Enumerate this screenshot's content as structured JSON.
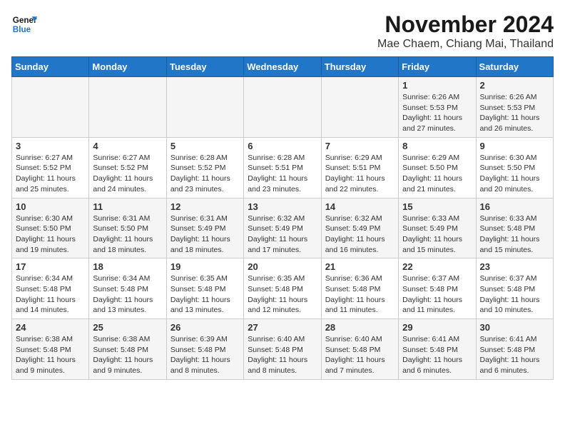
{
  "header": {
    "logo_line1": "General",
    "logo_line2": "Blue",
    "month": "November 2024",
    "location": "Mae Chaem, Chiang Mai, Thailand"
  },
  "weekdays": [
    "Sunday",
    "Monday",
    "Tuesday",
    "Wednesday",
    "Thursday",
    "Friday",
    "Saturday"
  ],
  "weeks": [
    [
      {
        "day": "",
        "sunrise": "",
        "sunset": "",
        "daylight": ""
      },
      {
        "day": "",
        "sunrise": "",
        "sunset": "",
        "daylight": ""
      },
      {
        "day": "",
        "sunrise": "",
        "sunset": "",
        "daylight": ""
      },
      {
        "day": "",
        "sunrise": "",
        "sunset": "",
        "daylight": ""
      },
      {
        "day": "",
        "sunrise": "",
        "sunset": "",
        "daylight": ""
      },
      {
        "day": "1",
        "sunrise": "Sunrise: 6:26 AM",
        "sunset": "Sunset: 5:53 PM",
        "daylight": "Daylight: 11 hours and 27 minutes."
      },
      {
        "day": "2",
        "sunrise": "Sunrise: 6:26 AM",
        "sunset": "Sunset: 5:53 PM",
        "daylight": "Daylight: 11 hours and 26 minutes."
      }
    ],
    [
      {
        "day": "3",
        "sunrise": "Sunrise: 6:27 AM",
        "sunset": "Sunset: 5:52 PM",
        "daylight": "Daylight: 11 hours and 25 minutes."
      },
      {
        "day": "4",
        "sunrise": "Sunrise: 6:27 AM",
        "sunset": "Sunset: 5:52 PM",
        "daylight": "Daylight: 11 hours and 24 minutes."
      },
      {
        "day": "5",
        "sunrise": "Sunrise: 6:28 AM",
        "sunset": "Sunset: 5:52 PM",
        "daylight": "Daylight: 11 hours and 23 minutes."
      },
      {
        "day": "6",
        "sunrise": "Sunrise: 6:28 AM",
        "sunset": "Sunset: 5:51 PM",
        "daylight": "Daylight: 11 hours and 23 minutes."
      },
      {
        "day": "7",
        "sunrise": "Sunrise: 6:29 AM",
        "sunset": "Sunset: 5:51 PM",
        "daylight": "Daylight: 11 hours and 22 minutes."
      },
      {
        "day": "8",
        "sunrise": "Sunrise: 6:29 AM",
        "sunset": "Sunset: 5:50 PM",
        "daylight": "Daylight: 11 hours and 21 minutes."
      },
      {
        "day": "9",
        "sunrise": "Sunrise: 6:30 AM",
        "sunset": "Sunset: 5:50 PM",
        "daylight": "Daylight: 11 hours and 20 minutes."
      }
    ],
    [
      {
        "day": "10",
        "sunrise": "Sunrise: 6:30 AM",
        "sunset": "Sunset: 5:50 PM",
        "daylight": "Daylight: 11 hours and 19 minutes."
      },
      {
        "day": "11",
        "sunrise": "Sunrise: 6:31 AM",
        "sunset": "Sunset: 5:50 PM",
        "daylight": "Daylight: 11 hours and 18 minutes."
      },
      {
        "day": "12",
        "sunrise": "Sunrise: 6:31 AM",
        "sunset": "Sunset: 5:49 PM",
        "daylight": "Daylight: 11 hours and 18 minutes."
      },
      {
        "day": "13",
        "sunrise": "Sunrise: 6:32 AM",
        "sunset": "Sunset: 5:49 PM",
        "daylight": "Daylight: 11 hours and 17 minutes."
      },
      {
        "day": "14",
        "sunrise": "Sunrise: 6:32 AM",
        "sunset": "Sunset: 5:49 PM",
        "daylight": "Daylight: 11 hours and 16 minutes."
      },
      {
        "day": "15",
        "sunrise": "Sunrise: 6:33 AM",
        "sunset": "Sunset: 5:49 PM",
        "daylight": "Daylight: 11 hours and 15 minutes."
      },
      {
        "day": "16",
        "sunrise": "Sunrise: 6:33 AM",
        "sunset": "Sunset: 5:48 PM",
        "daylight": "Daylight: 11 hours and 15 minutes."
      }
    ],
    [
      {
        "day": "17",
        "sunrise": "Sunrise: 6:34 AM",
        "sunset": "Sunset: 5:48 PM",
        "daylight": "Daylight: 11 hours and 14 minutes."
      },
      {
        "day": "18",
        "sunrise": "Sunrise: 6:34 AM",
        "sunset": "Sunset: 5:48 PM",
        "daylight": "Daylight: 11 hours and 13 minutes."
      },
      {
        "day": "19",
        "sunrise": "Sunrise: 6:35 AM",
        "sunset": "Sunset: 5:48 PM",
        "daylight": "Daylight: 11 hours and 13 minutes."
      },
      {
        "day": "20",
        "sunrise": "Sunrise: 6:35 AM",
        "sunset": "Sunset: 5:48 PM",
        "daylight": "Daylight: 11 hours and 12 minutes."
      },
      {
        "day": "21",
        "sunrise": "Sunrise: 6:36 AM",
        "sunset": "Sunset: 5:48 PM",
        "daylight": "Daylight: 11 hours and 11 minutes."
      },
      {
        "day": "22",
        "sunrise": "Sunrise: 6:37 AM",
        "sunset": "Sunset: 5:48 PM",
        "daylight": "Daylight: 11 hours and 11 minutes."
      },
      {
        "day": "23",
        "sunrise": "Sunrise: 6:37 AM",
        "sunset": "Sunset: 5:48 PM",
        "daylight": "Daylight: 11 hours and 10 minutes."
      }
    ],
    [
      {
        "day": "24",
        "sunrise": "Sunrise: 6:38 AM",
        "sunset": "Sunset: 5:48 PM",
        "daylight": "Daylight: 11 hours and 9 minutes."
      },
      {
        "day": "25",
        "sunrise": "Sunrise: 6:38 AM",
        "sunset": "Sunset: 5:48 PM",
        "daylight": "Daylight: 11 hours and 9 minutes."
      },
      {
        "day": "26",
        "sunrise": "Sunrise: 6:39 AM",
        "sunset": "Sunset: 5:48 PM",
        "daylight": "Daylight: 11 hours and 8 minutes."
      },
      {
        "day": "27",
        "sunrise": "Sunrise: 6:40 AM",
        "sunset": "Sunset: 5:48 PM",
        "daylight": "Daylight: 11 hours and 8 minutes."
      },
      {
        "day": "28",
        "sunrise": "Sunrise: 6:40 AM",
        "sunset": "Sunset: 5:48 PM",
        "daylight": "Daylight: 11 hours and 7 minutes."
      },
      {
        "day": "29",
        "sunrise": "Sunrise: 6:41 AM",
        "sunset": "Sunset: 5:48 PM",
        "daylight": "Daylight: 11 hours and 6 minutes."
      },
      {
        "day": "30",
        "sunrise": "Sunrise: 6:41 AM",
        "sunset": "Sunset: 5:48 PM",
        "daylight": "Daylight: 11 hours and 6 minutes."
      }
    ]
  ]
}
